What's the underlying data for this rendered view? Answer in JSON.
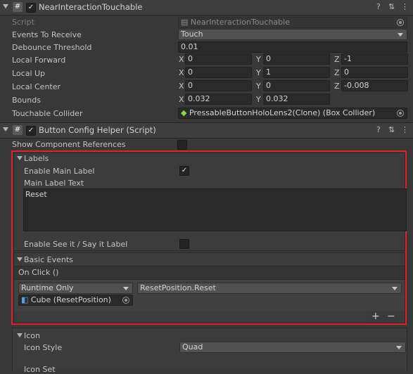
{
  "near": {
    "title": "NearInteractionTouchable",
    "script_label": "Script",
    "script_value": "NearInteractionTouchable",
    "events_label": "Events To Receive",
    "events_value": "Touch",
    "debounce_label": "Debounce Threshold",
    "debounce_value": "0.01",
    "fwd_label": "Local Forward",
    "fwd": {
      "x": "0",
      "y": "0",
      "z": "-1"
    },
    "up_label": "Local Up",
    "up": {
      "x": "0",
      "y": "1",
      "z": "0"
    },
    "center_label": "Local Center",
    "center": {
      "x": "0",
      "y": "0",
      "z": "-0.008"
    },
    "bounds_label": "Bounds",
    "bounds": {
      "x": "0.032",
      "y": "0.032"
    },
    "collider_label": "Touchable Collider",
    "collider_value": "PressableButtonHoloLens2(Clone) (Box Collider)"
  },
  "axes": {
    "x": "X",
    "y": "Y",
    "z": "Z"
  },
  "bch": {
    "title": "Button Config Helper (Script)",
    "show_refs_label": "Show Component References",
    "show_refs_checked": false,
    "labels_section": "Labels",
    "enable_main_label": "Enable Main Label",
    "enable_main_checked": true,
    "main_text_label": "Main Label Text",
    "main_text_value": "Reset",
    "see_it_label": "Enable See it / Say it Label",
    "see_it_checked": false,
    "basic_events": "Basic Events",
    "on_click": "On Click ()",
    "runtime": "Runtime Only",
    "method": "ResetPosition.Reset",
    "target": "Cube (ResetPosition)",
    "plus": "+",
    "minus": "−",
    "icon_section": "Icon",
    "icon_style_label": "Icon Style",
    "icon_style_value": "Quad",
    "icon_set_label": "Icon Set"
  },
  "colors": {
    "highlight": "#e0202a",
    "checkmark": "#e6e6e6"
  }
}
